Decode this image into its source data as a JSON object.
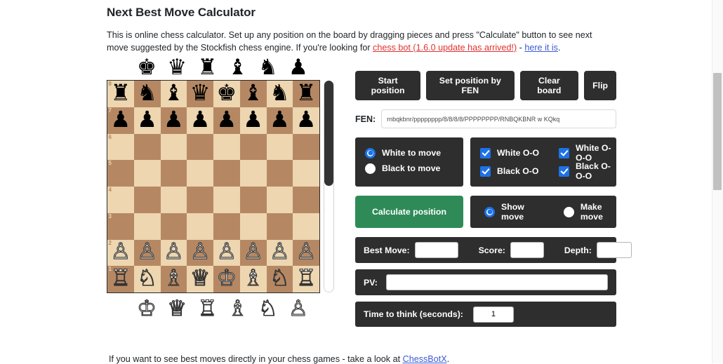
{
  "page": {
    "title": "Next Best Move Calculator",
    "intro_part1": "This is online chess calculator. Set up any position on the board by dragging pieces and press \"Calculate\" button to see next move suggested by the Stockfish chess engine. If you're looking for ",
    "intro_link_red": "chess bot (1.6.0 update has arrived!)",
    "intro_dash": " - ",
    "intro_link_blue": "here it is",
    "intro_period": ".",
    "footer_text": "If you want to see best moves directly in your chess games - take a look at ",
    "footer_link": "ChessBotX",
    "footer_period": "."
  },
  "colors": {
    "panel_dark": "#2e2e2e",
    "accent_blue": "#1d72e8",
    "calculate_green": "#2e8b57",
    "board_light": "#edd6b0",
    "board_dark": "#b58863",
    "link_red": "#e03131",
    "link_blue": "#3b5bd4"
  },
  "toolbar": {
    "buttons": [
      {
        "label": "Start position",
        "name": "start-position-button"
      },
      {
        "label": "Set position by FEN",
        "name": "set-position-by-fen-button"
      },
      {
        "label": "Clear board",
        "name": "clear-board-button"
      },
      {
        "label": "Flip",
        "name": "flip-button"
      }
    ]
  },
  "fen": {
    "label": "FEN:",
    "value": "rnbqkbnr/pppppppp/8/8/8/8/PPPPPPPP/RNBQKBNR w KQkq",
    "placeholder": ""
  },
  "turn": {
    "options": [
      {
        "label": "White to move",
        "selected": true
      },
      {
        "label": "Black to move",
        "selected": false
      }
    ]
  },
  "castling": {
    "options": [
      {
        "label": "White O-O",
        "checked": true
      },
      {
        "label": "White O-O-O",
        "checked": true
      },
      {
        "label": "Black O-O",
        "checked": true
      },
      {
        "label": "Black O-O-O",
        "checked": true
      }
    ]
  },
  "calculate": {
    "button_label": "Calculate position",
    "move_mode": [
      {
        "label": "Show move",
        "selected": true
      },
      {
        "label": "Make move",
        "selected": false
      }
    ]
  },
  "results": {
    "best_move_label": "Best Move:",
    "best_move_value": "",
    "score_label": "Score:",
    "score_value": "",
    "depth_label": "Depth:",
    "depth_value": "",
    "pv_label": "PV:",
    "pv_value": "",
    "time_label": "Time to think (seconds):",
    "time_value": "1"
  },
  "board": {
    "rank_labels": [
      "8",
      "7",
      "6",
      "5",
      "4",
      "3",
      "2",
      "1"
    ],
    "spare_black": [
      {
        "name": "spare-black-king",
        "glyph": "♚"
      },
      {
        "name": "spare-black-queen",
        "glyph": "♛"
      },
      {
        "name": "spare-black-rook",
        "glyph": "♜"
      },
      {
        "name": "spare-black-bishop",
        "glyph": "♝"
      },
      {
        "name": "spare-black-knight",
        "glyph": "♞"
      },
      {
        "name": "spare-black-pawn",
        "glyph": "♟"
      }
    ],
    "spare_white": [
      {
        "name": "spare-white-king",
        "glyph": "♔"
      },
      {
        "name": "spare-white-queen",
        "glyph": "♕"
      },
      {
        "name": "spare-white-rook",
        "glyph": "♖"
      },
      {
        "name": "spare-white-bishop",
        "glyph": "♗"
      },
      {
        "name": "spare-white-knight",
        "glyph": "♘"
      },
      {
        "name": "spare-white-pawn",
        "glyph": "♙"
      }
    ],
    "position": [
      [
        "r",
        "n",
        "b",
        "q",
        "k",
        "b",
        "n",
        "r"
      ],
      [
        "p",
        "p",
        "p",
        "p",
        "p",
        "p",
        "p",
        "p"
      ],
      [
        "",
        "",
        "",
        "",
        "",
        "",
        "",
        ""
      ],
      [
        "",
        "",
        "",
        "",
        "",
        "",
        "",
        ""
      ],
      [
        "",
        "",
        "",
        "",
        "",
        "",
        "",
        ""
      ],
      [
        "",
        "",
        "",
        "",
        "",
        "",
        "",
        ""
      ],
      [
        "P",
        "P",
        "P",
        "P",
        "P",
        "P",
        "P",
        "P"
      ],
      [
        "R",
        "N",
        "B",
        "Q",
        "K",
        "B",
        "N",
        "R"
      ]
    ],
    "piece_glyphs": {
      "k": "♚",
      "q": "♛",
      "r": "♜",
      "b": "♝",
      "n": "♞",
      "p": "♟",
      "K": "♔",
      "Q": "♕",
      "R": "♖",
      "B": "♗",
      "N": "♘",
      "P": "♙"
    },
    "scrollbar": {
      "name": "board-scrollbar"
    }
  }
}
